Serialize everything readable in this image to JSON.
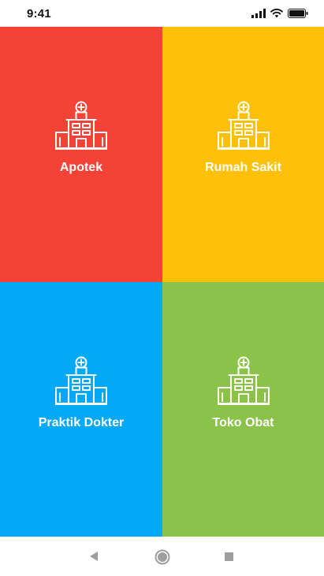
{
  "status": {
    "time": "9:41",
    "icons": [
      "signal-icon",
      "wifi-icon",
      "battery-icon"
    ]
  },
  "tiles": [
    {
      "label": "Apotek",
      "color": "#F44336",
      "icon": "hospital-icon"
    },
    {
      "label": "Rumah Sakit",
      "color": "#FFC107",
      "icon": "hospital-icon"
    },
    {
      "label": "Praktik Dokter",
      "color": "#03A9F4",
      "icon": "hospital-icon"
    },
    {
      "label": "Toko Obat",
      "color": "#8BC34A",
      "icon": "hospital-icon"
    }
  ],
  "nav": {
    "buttons": [
      "back-icon",
      "home-icon",
      "recent-apps-icon"
    ],
    "color": "#9E9E9E"
  }
}
